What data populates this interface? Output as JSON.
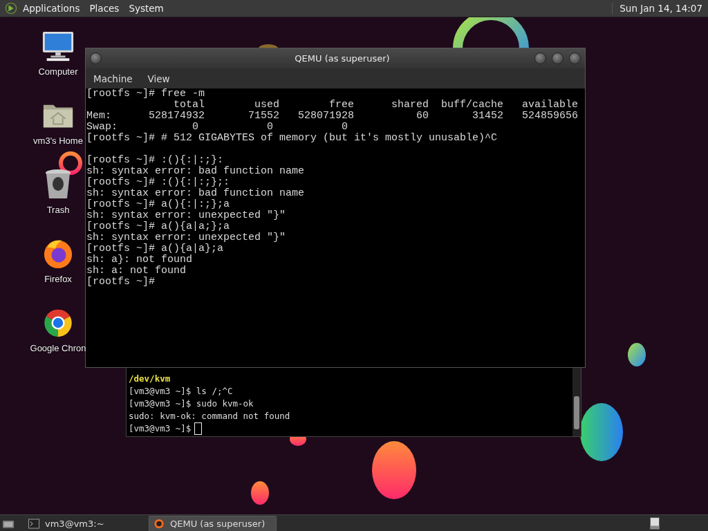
{
  "top_panel": {
    "menus": [
      {
        "label": "Applications"
      },
      {
        "label": "Places"
      },
      {
        "label": "System"
      }
    ],
    "clock": "Sun Jan 14, 14:07"
  },
  "desktop_icons": [
    {
      "label": "Computer",
      "kind": "computer"
    },
    {
      "label": "vm3's Home",
      "kind": "home"
    },
    {
      "label": "Trash",
      "kind": "trash"
    },
    {
      "label": "Firefox",
      "kind": "firefox"
    },
    {
      "label": "Google Chron",
      "kind": "chrome"
    }
  ],
  "terminal": {
    "lines": [
      {
        "text": "/dev/kvm",
        "kind": "path"
      },
      {
        "text": "[vm3@vm3 ~]$ ls /;^C",
        "kind": "plain"
      },
      {
        "text": "[vm3@vm3 ~]$ sudo kvm-ok",
        "kind": "plain"
      },
      {
        "text": "sudo: kvm-ok: command not found",
        "kind": "plain"
      }
    ],
    "prompt": "[vm3@vm3 ~]$"
  },
  "qemu_window": {
    "title": "QEMU (as superuser)",
    "menus": [
      {
        "label": "Machine"
      },
      {
        "label": "View"
      }
    ],
    "console_blocks": [
      {
        "lines": [
          "[rootfs ~]# free -m",
          "              total        used        free      shared  buff/cache   available",
          "Mem:      528174932       71552   528071928          60       31452   524859656",
          "Swap:            0           0           0",
          "[rootfs ~]# # 512 GIGABYTES of memory (but it's mostly unusable)^C"
        ]
      },
      {
        "lines": [
          "[rootfs ~]# :(){:|:;}:",
          "sh: syntax error: bad function name",
          "[rootfs ~]# :(){:|:;};:",
          "sh: syntax error: bad function name",
          "[rootfs ~]# a(){:|:;};a",
          "sh: syntax error: unexpected \"}\"",
          "[rootfs ~]# a(){a|a;};a",
          "sh: syntax error: unexpected \"}\"",
          "[rootfs ~]# a(){a|a};a",
          "sh: a}: not found",
          "sh: a: not found",
          "[rootfs ~]#"
        ]
      }
    ]
  },
  "taskbar": {
    "items": [
      {
        "label": "vm3@vm3:~",
        "kind": "terminal",
        "selected": false
      },
      {
        "label": "QEMU (as superuser)",
        "kind": "qemu",
        "selected": true
      }
    ]
  }
}
